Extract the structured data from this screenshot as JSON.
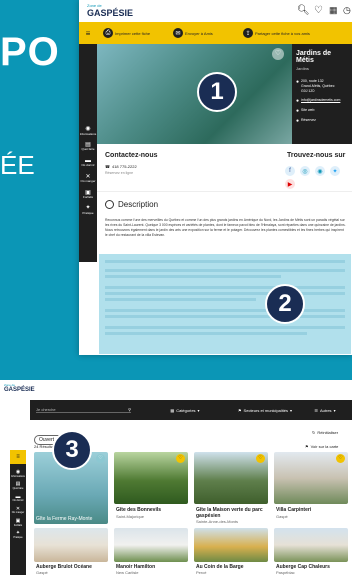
{
  "background_text": {
    "top": "PO",
    "mid": "ÉE"
  },
  "panel1": {
    "logo_small": "Zone de",
    "logo": "GASPÉSIE",
    "actions": [
      "Imprimer cette fiche",
      "Envoyer à Amis",
      "Partager cette fiche à vos amis"
    ],
    "title": "Jardins de Métis",
    "category": "Jardins",
    "address": [
      "200, route 132",
      "Grand-Métis, Québec",
      "G0J 1Z0"
    ],
    "email": "info@jardinsdemetis.com",
    "site": "Site web",
    "booking": "Réservez",
    "contact_title": "Contactez-nous",
    "phone": "418 775-2222",
    "phone_label": "Réservez en ligne",
    "social_title": "Trouvez-nous sur",
    "desc_title": "Description",
    "desc_text": "Reconnus comme l'une des merveilles du Québec et comme l'un des plus grands jardins en Amérique du Nord, les Jardins de Métis sont un paradis végétal sur les rives du Saint-Laurent. Quelque 3 000 espèces et variétés de plantes, dont le fameux pavot bleu de l'Himalaya, sont réparties dans une quinzaine de jardins. Nous retrouvons également dans le jardin des arts une exposition sur la ferme et le potager. Découvrez les plantes comestibles et les fines herbes qui inspirent le chef du restaurant de la villa Estevan.",
    "nav": [
      "Informations",
      "Quoi faire",
      "Où dormir",
      "Où manger",
      "Forfaits",
      "Pratique"
    ],
    "badge": "1"
  },
  "panel2": {
    "badge": "2"
  },
  "panel3": {
    "logo_small": "Zone de",
    "logo": "GASPÉSIE",
    "search_placeholder": "Je cherche",
    "filters": [
      "Catégories",
      "Secteurs et municipalités",
      "Autres"
    ],
    "open_label": "Ouvert ce jour",
    "reset": "Réinitialiser",
    "results": "24 Résultats",
    "map_link": "Voir sur la carte",
    "nav": [
      "Informations",
      "Quoi faire",
      "Où dormir",
      "Où manger",
      "Forfaits",
      "Pratique"
    ],
    "badge": "3",
    "cards": [
      {
        "name": "Gîte la Ferme Ray-Monte",
        "place": "Grande-Rivière"
      },
      {
        "name": "Gîte des Bonnevils",
        "place": "Saint-Majorique"
      },
      {
        "name": "Gîte la Maison verte du parc gaspésien",
        "place": "Sainte-Anne-des-Monts"
      },
      {
        "name": "Villa Carpinteri",
        "place": "Gaspé"
      },
      {
        "name": "Auberge Brulot Océane",
        "place": "Gaspé"
      },
      {
        "name": "Manoir Hamilton",
        "place": "New Carlisle"
      },
      {
        "name": "Au Coin de la Barge",
        "place": "Percé"
      },
      {
        "name": "Auberge Cap Chaleurs",
        "place": "Paspébiac"
      }
    ]
  },
  "colors": {
    "brand": "#0b96b6",
    "accent": "#f2c300",
    "badge": "#1a2d54"
  }
}
